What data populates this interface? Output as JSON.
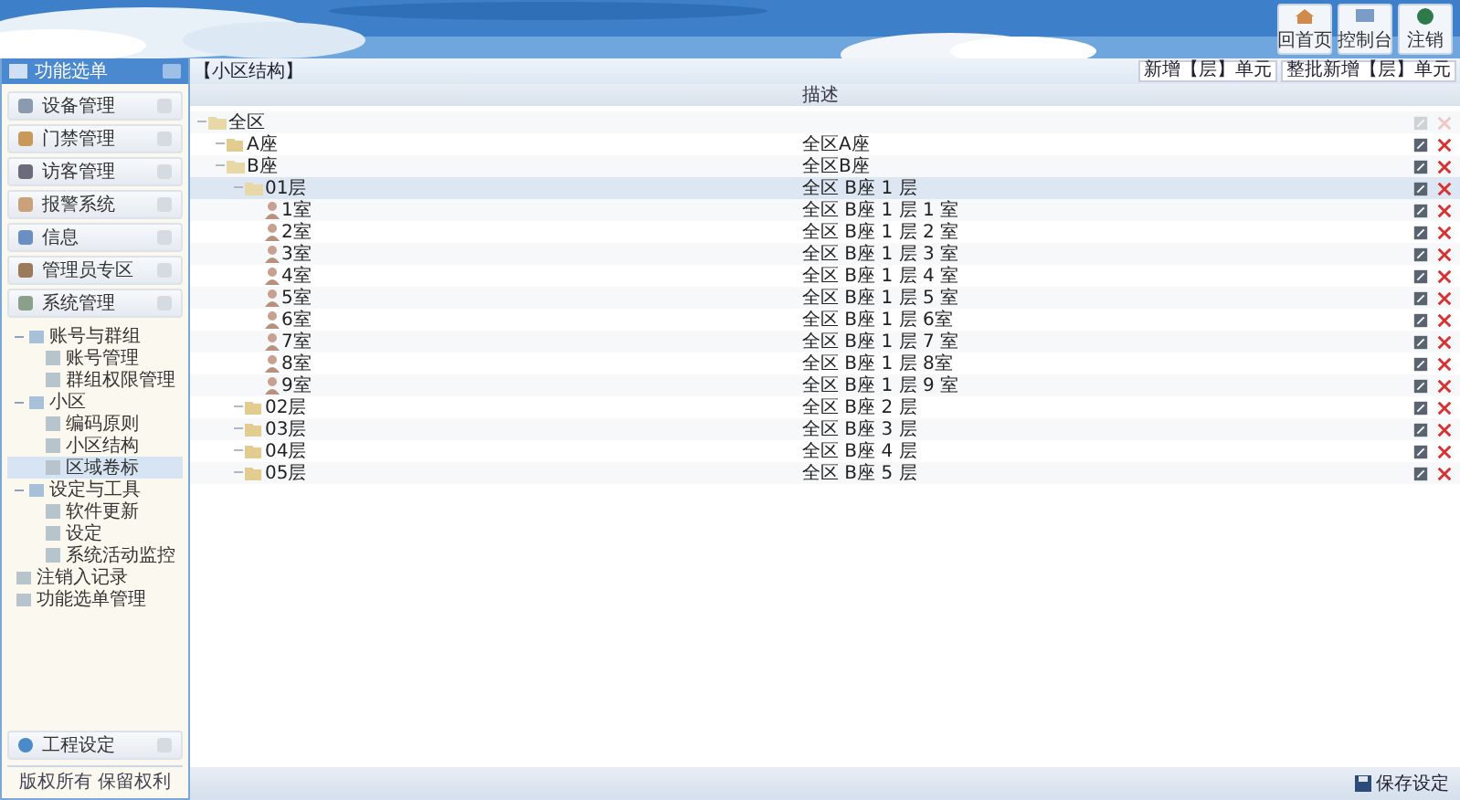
{
  "header": {
    "buttons": [
      {
        "label": "回首页",
        "kind": "home"
      },
      {
        "label": "控制台",
        "kind": "console"
      },
      {
        "label": "注销",
        "kind": "logout"
      }
    ]
  },
  "sidebar": {
    "title": "功能选单",
    "menu": [
      {
        "label": "设备管理",
        "kind": "device"
      },
      {
        "label": "门禁管理",
        "kind": "door"
      },
      {
        "label": "访客管理",
        "kind": "visitor"
      },
      {
        "label": "报警系统",
        "kind": "alarm"
      },
      {
        "label": "信息",
        "kind": "info"
      },
      {
        "label": "管理员专区",
        "kind": "admin"
      },
      {
        "label": "系统管理",
        "kind": "system"
      }
    ],
    "tree": [
      {
        "label": "账号与群组",
        "expanded": true,
        "selected": false,
        "children": [
          {
            "label": "账号管理",
            "selected": false
          },
          {
            "label": "群组权限管理",
            "selected": false
          }
        ]
      },
      {
        "label": "小区",
        "expanded": true,
        "selected": false,
        "children": [
          {
            "label": "编码原则",
            "selected": false
          },
          {
            "label": "小区结构",
            "selected": false
          },
          {
            "label": "区域卷标",
            "selected": true
          }
        ]
      },
      {
        "label": "设定与工具",
        "expanded": true,
        "selected": false,
        "children": [
          {
            "label": "软件更新",
            "selected": false
          },
          {
            "label": "设定",
            "selected": false
          },
          {
            "label": "系统活动监控",
            "selected": false
          }
        ]
      },
      {
        "label": "注销入记录",
        "selected": false
      },
      {
        "label": "功能选单管理",
        "selected": false
      }
    ],
    "bottom_item": "工程设定",
    "footer": "版权所有 保留权利"
  },
  "main": {
    "title": "【小区结构】",
    "toolbar": [
      "新增【层】单元",
      "整批新增【层】单元"
    ],
    "column": "描述",
    "rows": [
      {
        "name": "全区",
        "kind": "folder",
        "description": "",
        "expanded": true,
        "selected": false,
        "actions_disabled": true,
        "children": [
          {
            "name": "A座",
            "kind": "folder",
            "description": "全区A座",
            "expanded": false,
            "selected": false,
            "actions_disabled": false
          },
          {
            "name": "B座",
            "kind": "folder",
            "description": "全区B座",
            "expanded": true,
            "selected": false,
            "actions_disabled": false,
            "children": [
              {
                "name": "01层",
                "kind": "folder",
                "description": "全区 B座 1 层",
                "expanded": true,
                "selected": true,
                "actions_disabled": false,
                "children": [
                  {
                    "name": "1室",
                    "kind": "room",
                    "description": "全区 B座 1 层 1 室",
                    "selected": false,
                    "actions_disabled": false
                  },
                  {
                    "name": "2室",
                    "kind": "room",
                    "description": "全区 B座 1 层 2 室",
                    "selected": false,
                    "actions_disabled": false
                  },
                  {
                    "name": "3室",
                    "kind": "room",
                    "description": "全区 B座 1 层 3 室",
                    "selected": false,
                    "actions_disabled": false
                  },
                  {
                    "name": "4室",
                    "kind": "room",
                    "description": "全区 B座 1 层 4 室",
                    "selected": false,
                    "actions_disabled": false
                  },
                  {
                    "name": "5室",
                    "kind": "room",
                    "description": "全区 B座 1 层 5 室",
                    "selected": false,
                    "actions_disabled": false
                  },
                  {
                    "name": "6室",
                    "kind": "room",
                    "description": "全区 B座 1 层 6室",
                    "selected": false,
                    "actions_disabled": false
                  },
                  {
                    "name": "7室",
                    "kind": "room",
                    "description": "全区 B座 1 层 7 室",
                    "selected": false,
                    "actions_disabled": false
                  },
                  {
                    "name": "8室",
                    "kind": "room",
                    "description": "全区 B座 1 层 8室",
                    "selected": false,
                    "actions_disabled": false
                  },
                  {
                    "name": "9室",
                    "kind": "room",
                    "description": "全区 B座 1 层 9 室",
                    "selected": false,
                    "actions_disabled": false
                  }
                ]
              },
              {
                "name": "02层",
                "kind": "folder",
                "description": "全区 B座 2 层",
                "expanded": false,
                "selected": false,
                "actions_disabled": false
              },
              {
                "name": "03层",
                "kind": "folder",
                "description": "全区 B座 3 层",
                "expanded": false,
                "selected": false,
                "actions_disabled": false
              },
              {
                "name": "04层",
                "kind": "folder",
                "description": "全区 B座 4 层",
                "expanded": false,
                "selected": false,
                "actions_disabled": false
              },
              {
                "name": "05层",
                "kind": "folder",
                "description": "全区 B座 5 层",
                "expanded": false,
                "selected": false,
                "actions_disabled": false
              }
            ]
          }
        ]
      }
    ]
  },
  "footer": {
    "button": "保存设定"
  }
}
